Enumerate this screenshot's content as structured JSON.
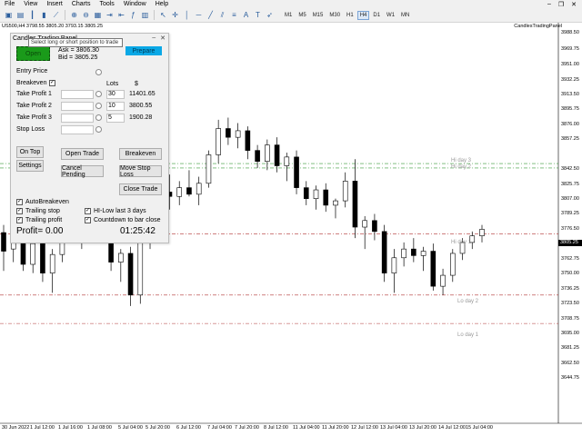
{
  "menu": [
    "File",
    "View",
    "Insert",
    "Charts",
    "Tools",
    "Window",
    "Help"
  ],
  "window_controls": {
    "minimize": "–",
    "restore": "❐",
    "close": "✕"
  },
  "timeframes": [
    {
      "label": "M1",
      "active": false
    },
    {
      "label": "M5",
      "active": false
    },
    {
      "label": "M15",
      "active": false
    },
    {
      "label": "M30",
      "active": false
    },
    {
      "label": "H1",
      "active": false
    },
    {
      "label": "H4",
      "active": true
    },
    {
      "label": "D1",
      "active": false
    },
    {
      "label": "W1",
      "active": false
    },
    {
      "label": "MN",
      "active": false
    }
  ],
  "chart": {
    "symbol_info": "US500,H4  3798.55 3805.20 3793.15 3805.25",
    "tab_label": "CandlesTradingPanel",
    "current_price": "3805.25",
    "price_levels": [
      "3988.50",
      "3969.75",
      "3951.00",
      "3932.25",
      "3913.50",
      "3895.75",
      "3876.00",
      "3857.25",
      "3842.50",
      "3825.75",
      "3807.00",
      "3789.25",
      "3776.50",
      "3762.75",
      "3750.00",
      "3736.25",
      "3723.50",
      "3708.75",
      "3695.00",
      "3681.25",
      "3662.50",
      "3644.75"
    ],
    "dates": [
      "30 Jun 2022",
      "1 Jul 12:00",
      "1 Jul 16:00",
      "1 Jul 08:00",
      "5 Jul 04:00",
      "5 Jul 20:00",
      "6 Jul 12:00",
      "7 Jul 04:00",
      "7 Jul 20:00",
      "8 Jul 12:00",
      "11 Jul 04:00",
      "11 Jul 20:00",
      "12 Jul 12:00",
      "13 Jul 04:00",
      "13 Jul 20:00",
      "14 Jul 12:00",
      "15 Jul 04:00"
    ],
    "hl_labels": {
      "hi3": "Hi day 3",
      "hi2": "Hi day 2",
      "hi1": "Hi day 1",
      "lo2": "Lo day 2",
      "lo1": "Lo day 1"
    },
    "candles": [
      [
        3805,
        3812,
        3770,
        3788
      ],
      [
        3790,
        3820,
        3778,
        3812
      ],
      [
        3812,
        3818,
        3770,
        3776
      ],
      [
        3776,
        3800,
        3768,
        3795
      ],
      [
        3795,
        3802,
        3760,
        3768
      ],
      [
        3768,
        3790,
        3750,
        3785
      ],
      [
        3785,
        3816,
        3778,
        3810
      ],
      [
        3810,
        3832,
        3796,
        3800
      ],
      [
        3800,
        3825,
        3790,
        3818
      ],
      [
        3818,
        3828,
        3800,
        3822
      ],
      [
        3822,
        3830,
        3812,
        3815
      ],
      [
        3815,
        3822,
        3770,
        3778
      ],
      [
        3778,
        3790,
        3760,
        3786
      ],
      [
        3786,
        3792,
        3738,
        3748
      ],
      [
        3748,
        3800,
        3740,
        3796
      ],
      [
        3796,
        3830,
        3790,
        3826
      ],
      [
        3826,
        3848,
        3820,
        3842
      ],
      [
        3842,
        3858,
        3826,
        3838
      ],
      [
        3838,
        3852,
        3830,
        3846
      ],
      [
        3846,
        3862,
        3838,
        3840
      ],
      [
        3840,
        3856,
        3830,
        3850
      ],
      [
        3850,
        3880,
        3846,
        3876
      ],
      [
        3876,
        3908,
        3868,
        3900
      ],
      [
        3900,
        3910,
        3885,
        3892
      ],
      [
        3892,
        3905,
        3882,
        3898
      ],
      [
        3898,
        3902,
        3872,
        3880
      ],
      [
        3880,
        3885,
        3864,
        3870
      ],
      [
        3870,
        3890,
        3862,
        3885
      ],
      [
        3885,
        3892,
        3860,
        3866
      ],
      [
        3866,
        3878,
        3852,
        3874
      ],
      [
        3874,
        3880,
        3840,
        3846
      ],
      [
        3846,
        3852,
        3830,
        3836
      ],
      [
        3836,
        3848,
        3826,
        3844
      ],
      [
        3844,
        3850,
        3824,
        3830
      ],
      [
        3830,
        3836,
        3818,
        3834
      ],
      [
        3834,
        3860,
        3828,
        3852
      ],
      [
        3852,
        3872,
        3800,
        3810
      ],
      [
        3810,
        3820,
        3790,
        3816
      ],
      [
        3816,
        3822,
        3798,
        3806
      ],
      [
        3806,
        3812,
        3760,
        3768
      ],
      [
        3768,
        3790,
        3750,
        3782
      ],
      [
        3782,
        3796,
        3774,
        3790
      ],
      [
        3790,
        3800,
        3778,
        3784
      ],
      [
        3784,
        3792,
        3770,
        3788
      ],
      [
        3788,
        3795,
        3752,
        3756
      ],
      [
        3756,
        3772,
        3748,
        3766
      ],
      [
        3766,
        3790,
        3760,
        3786
      ],
      [
        3786,
        3800,
        3780,
        3796
      ],
      [
        3796,
        3806,
        3790,
        3802
      ],
      [
        3802,
        3812,
        3796,
        3808
      ]
    ],
    "levels": {
      "hi3": 3868,
      "hi2": 3864,
      "hi1": 3804,
      "lo2": 3748,
      "lo1": 3722
    }
  },
  "panel": {
    "title": "Candles Trading Panel",
    "status_label": "Open",
    "ask": "Ask = 3806.30",
    "bid": "Bid = 3805.25",
    "prepare": "Prepare",
    "tooltip": "Select long or short position to trade",
    "entry_price": "Entry Price",
    "breakeven": "Breakeven",
    "lots": "Lots",
    "dollar": "$",
    "tp1": "Take Profit 1",
    "tp2": "Take Profit 2",
    "tp3": "Take Profit 3",
    "sl": "Stop Loss",
    "tp1_pct": "30",
    "tp2_pct": "10",
    "tp3_pct": "5",
    "tp1_val": "11401.65",
    "tp2_val": "3800.55",
    "tp3_val": "1900.28",
    "on_top": "On Top",
    "settings": "Settings",
    "open_trade": "Open Trade",
    "breakeven_btn": "Breakeven",
    "cancel_pending": "Cancel Pending",
    "move_stop_loss": "Move Stop Loss",
    "close_trade": "Close Trade",
    "auto_breakeven": "AutoBreakeven",
    "trailing_stop": "Trailing stop",
    "trailing_profit": "Trailing profit",
    "hi_low": "HI-Low last 3 days",
    "countdown_label": "Countdown to bar close",
    "profit": "Profit= 0.00",
    "countdown": "01:25:42"
  }
}
